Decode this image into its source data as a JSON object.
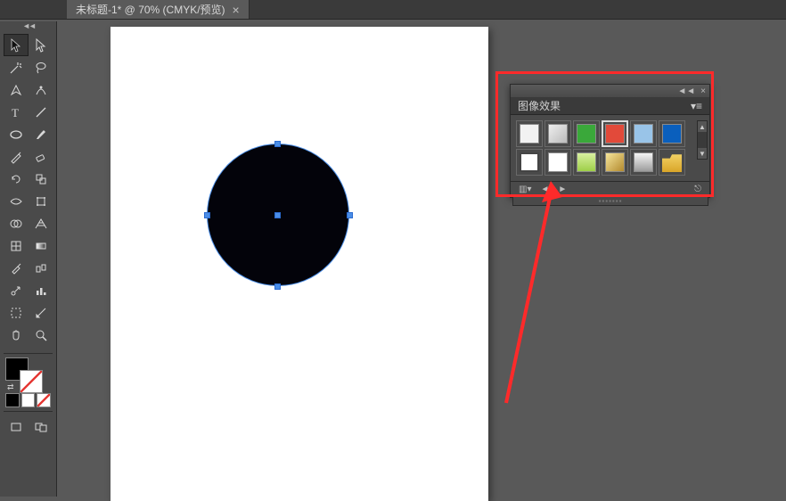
{
  "tab": {
    "title": "未标题-1* @ 70% (CMYK/预览)"
  },
  "toolbox": {
    "tools": [
      "selection",
      "direct-selection",
      "magic-wand",
      "lasso",
      "pen",
      "curvature-pen",
      "type",
      "line-segment",
      "ellipse",
      "paintbrush",
      "pencil",
      "eraser",
      "rotate",
      "scale",
      "width",
      "free-transform",
      "shape-builder",
      "perspective-grid",
      "mesh",
      "gradient",
      "eyedropper",
      "blend",
      "symbol-sprayer",
      "column-graph",
      "artboard",
      "slice",
      "hand",
      "zoom"
    ]
  },
  "panel": {
    "title": "图像效果",
    "styles_row1": [
      {
        "name": "default",
        "bg": "#f2f2f2"
      },
      {
        "name": "silver",
        "bg": "linear-gradient(135deg,#eee,#bbb)"
      },
      {
        "name": "green",
        "bg": "#3aa83a"
      },
      {
        "name": "red",
        "bg": "#e24a3a",
        "selected": true
      },
      {
        "name": "lightblue",
        "bg": "#99c4e8"
      },
      {
        "name": "blue",
        "bg": "#0a5fbd"
      }
    ],
    "styles_row2": [
      {
        "name": "outline",
        "bg": "#fff",
        "outline": true
      },
      {
        "name": "white",
        "bg": "#fff"
      },
      {
        "name": "lime-grad",
        "bg": "linear-gradient(#d8f0a0,#9ecf48)"
      },
      {
        "name": "gold-grad",
        "bg": "linear-gradient(135deg,#f5e59a,#b38a2e)"
      },
      {
        "name": "chrome",
        "bg": "linear-gradient(#f5f5f5,#9c9c9c)"
      },
      {
        "name": "folder",
        "bg": "#f0c53a",
        "shape": "folder"
      }
    ],
    "footer_icons": {
      "lib": "库",
      "prev": "◄",
      "next": "►",
      "break": "✕"
    }
  }
}
